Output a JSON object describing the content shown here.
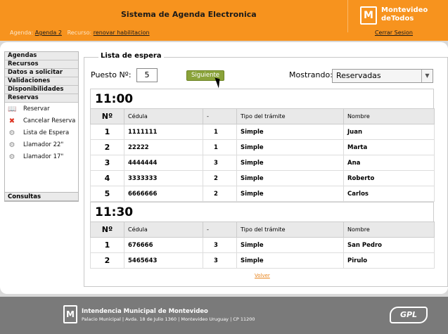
{
  "header": {
    "title": "Sistema de Agenda Electronica",
    "agenda_label": "Agenda:",
    "agenda_value": "Agenda 2",
    "recurso_label": "Recurso:",
    "recurso_value": "renovar habilitacion",
    "logout": "Cerrar Sesion",
    "logo_mark": "M",
    "logo_line1": "Montevideo",
    "logo_line2": "deTodos"
  },
  "sidebar": {
    "menu": [
      "Agendas",
      "Recursos",
      "Datos a solicitar",
      "Validaciones",
      "Disponibilidades",
      "Reservas"
    ],
    "submenu": [
      {
        "label": "Reservar",
        "icon": "book-icon"
      },
      {
        "label": "Cancelar Reserva",
        "icon": "cancel-x-icon"
      },
      {
        "label": "Lista de Espera",
        "icon": "gear-icon"
      },
      {
        "label": "Llamador 22\"",
        "icon": "gear-icon"
      },
      {
        "label": "Llamador 17\"",
        "icon": "gear-icon"
      }
    ],
    "consultas": "Consultas"
  },
  "main": {
    "legend": "Lista de espera",
    "puesto_label": "Puesto Nº:",
    "puesto_value": "5",
    "siguiente": "Siguiente",
    "mostrando_label": "Mostrando:",
    "mostrando_value": "Reservadas",
    "columns": [
      "Nº",
      "Cédula",
      "-",
      "Tipo del trámite",
      "Nombre"
    ],
    "groups": [
      {
        "time": "11:00",
        "rows": [
          [
            "1",
            "1111111",
            "1",
            "Simple",
            "Juan"
          ],
          [
            "2",
            "22222",
            "1",
            "Simple",
            "Marta"
          ],
          [
            "3",
            "4444444",
            "3",
            "Simple",
            "Ana"
          ],
          [
            "4",
            "3333333",
            "2",
            "Simple",
            "Roberto"
          ],
          [
            "5",
            "6666666",
            "2",
            "Simple",
            "Carlos"
          ]
        ]
      },
      {
        "time": "11:30",
        "rows": [
          [
            "1",
            "676666",
            "3",
            "Simple",
            "San Pedro"
          ],
          [
            "2",
            "5465643",
            "3",
            "Simple",
            "Pirulo"
          ]
        ]
      }
    ],
    "volver": "Volver"
  },
  "footer": {
    "logo_mark": "M",
    "title": "Intendencia Municipal de Montevideo",
    "address": "Palacio Municipal | Avda. 18 de Julio 1360 | Montevideo Uruguay | CP 11200",
    "gpl": "GPL"
  }
}
